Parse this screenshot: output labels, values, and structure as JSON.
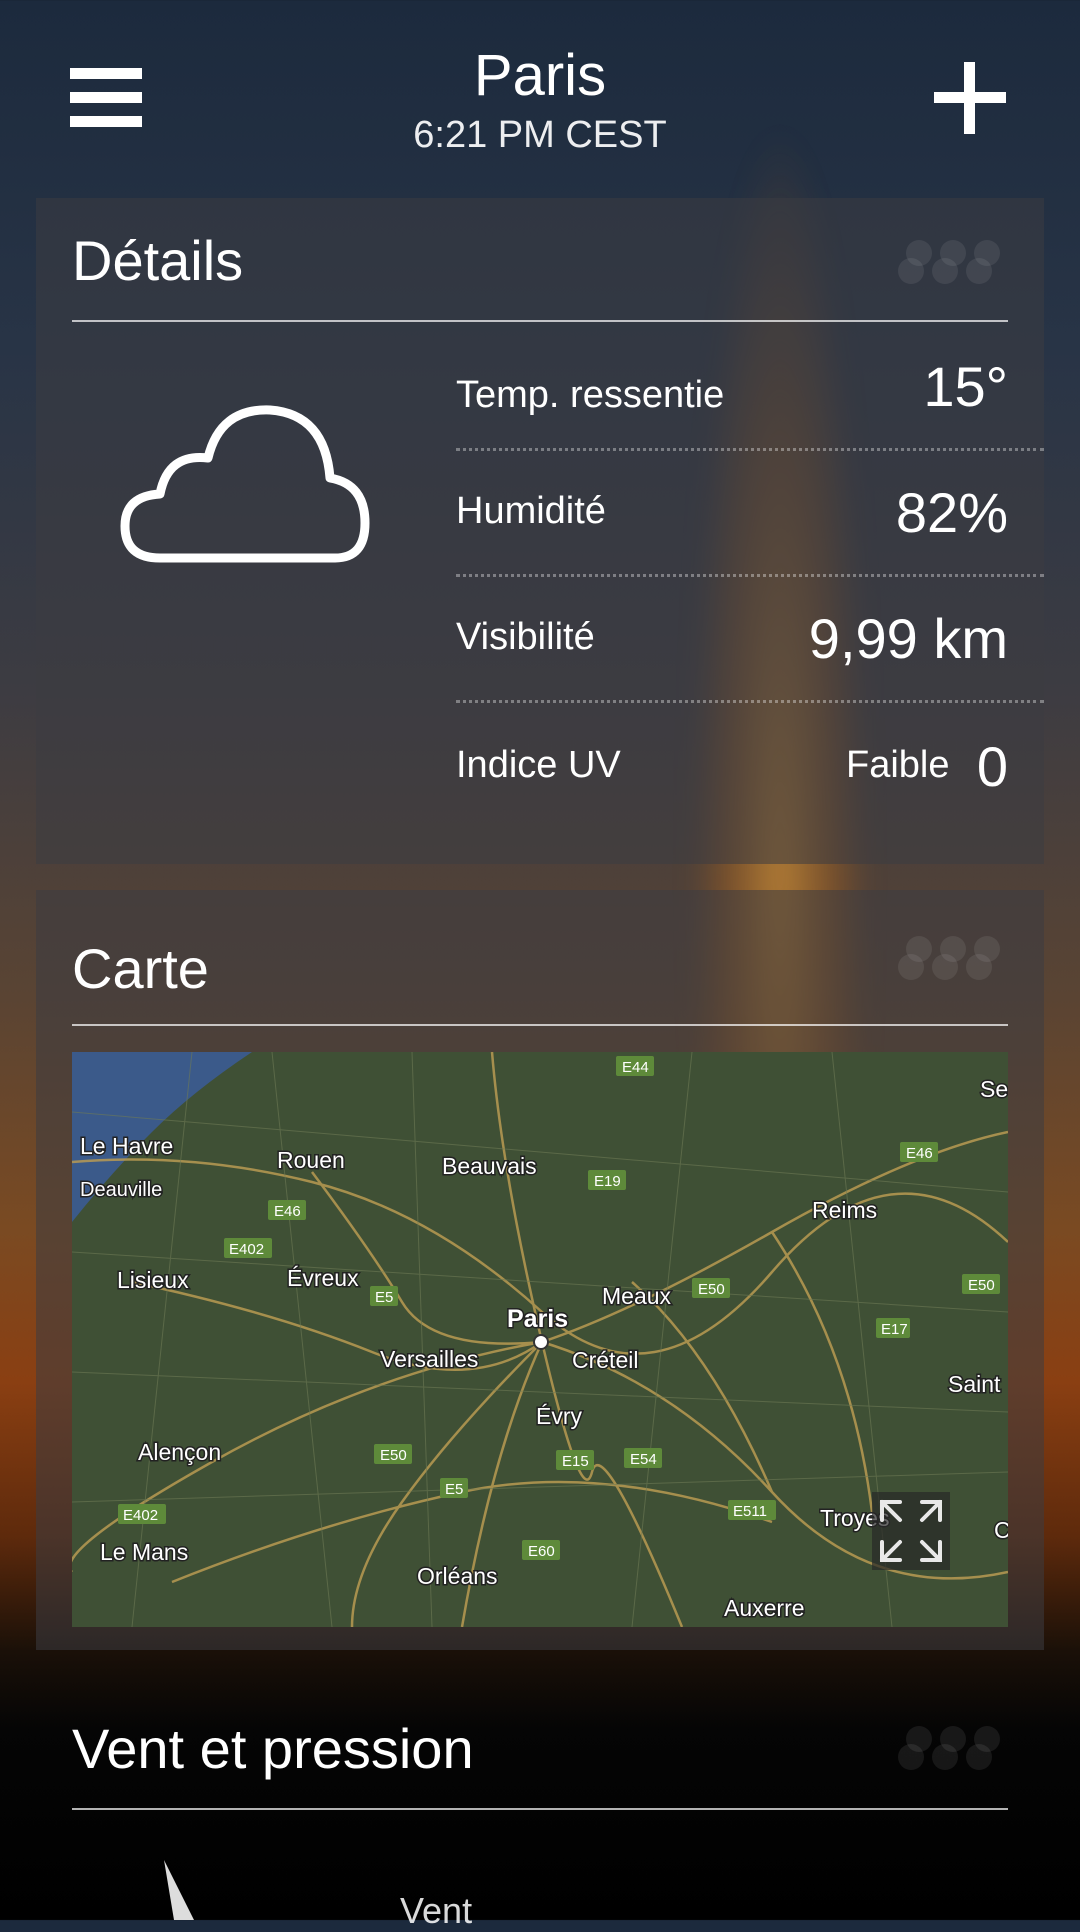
{
  "header": {
    "city": "Paris",
    "time": "6:21 PM CEST"
  },
  "details": {
    "title": "Détails",
    "condition_icon": "cloud-icon",
    "rows": [
      {
        "label": "Temp. ressentie",
        "value": "15°"
      },
      {
        "label": "Humidité",
        "value": "82%"
      },
      {
        "label": "Visibilité",
        "value": "9,99 km"
      },
      {
        "label": "Indice UV",
        "qualifier": "Faible",
        "value": "0"
      }
    ]
  },
  "map_card": {
    "title": "Carte",
    "cities": [
      "Le Havre",
      "Deauville",
      "Rouen",
      "Beauvais",
      "Reims",
      "Lisieux",
      "Évreux",
      "Meaux",
      "Paris",
      "Versailles",
      "Créteil",
      "Évry",
      "Alençon",
      "Troyes",
      "Le Mans",
      "Orléans",
      "Auxerre",
      "Saint",
      "Se",
      "C"
    ],
    "roads": [
      "E44",
      "E46",
      "E19",
      "E46",
      "E402",
      "E5",
      "E50",
      "E50",
      "E17",
      "E50",
      "E15",
      "E54",
      "E5",
      "E511",
      "E402",
      "E60"
    ]
  },
  "wind_card": {
    "title": "Vent et pression",
    "wind_label": "Vent"
  },
  "colors": {
    "accent": "#ffffff",
    "road_badge": "#5e8a3a",
    "map_land": "#3d4d35"
  }
}
